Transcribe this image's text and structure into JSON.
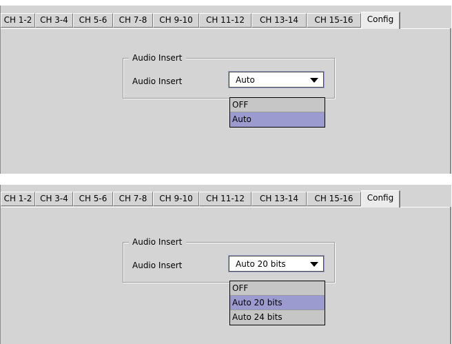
{
  "tabs": [
    "CH 1-2",
    "CH 3-4",
    "CH 5-6",
    "CH 7-8",
    "CH 9-10",
    "CH 11-12",
    "CH 13-14",
    "CH 15-16",
    "Config"
  ],
  "active_tab": "Config",
  "panel1": {
    "group_title": "Audio Insert",
    "field_label": "Audio Insert",
    "selected_value": "Auto",
    "options": [
      "OFF",
      "Auto"
    ],
    "highlighted_option": "Auto"
  },
  "panel2": {
    "group_title": "Audio Insert",
    "field_label": "Audio Insert",
    "selected_value": "Auto 20 bits",
    "options": [
      "OFF",
      "Auto 20 bits",
      "Auto 24 bits"
    ],
    "highlighted_option": "Auto 20 bits"
  },
  "colors": {
    "panel_bg": "#d4d4d4",
    "highlight": "#9b9bcf",
    "option_bg": "#c6c6c6"
  }
}
